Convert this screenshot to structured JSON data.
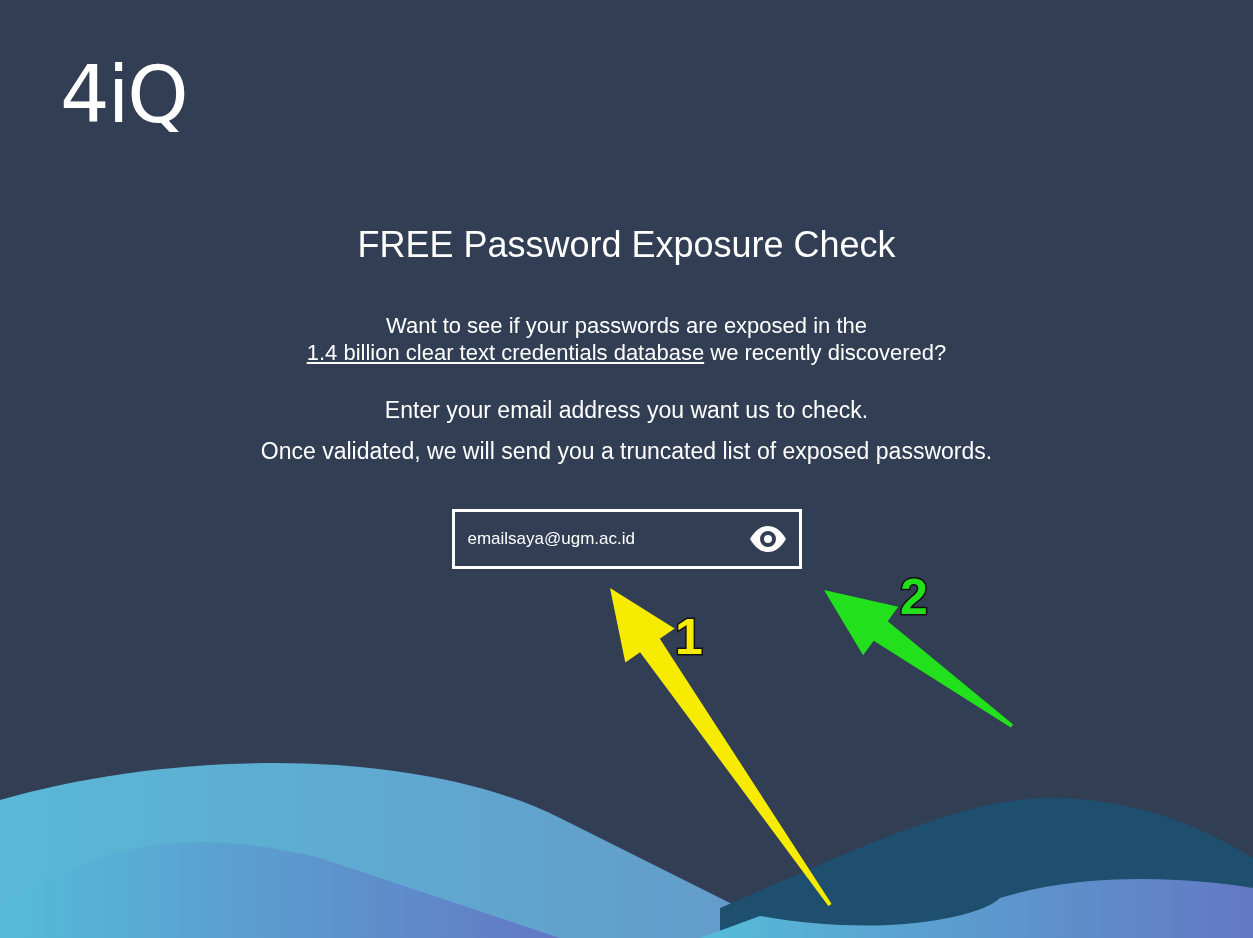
{
  "logo": {
    "text": "4iQ"
  },
  "title": "FREE Password Exposure Check",
  "intro": {
    "before": "Want to see if your passwords are exposed in the",
    "link": "1.4 billion clear text credentials database",
    "after": "we recently discovered?"
  },
  "instructions": [
    "Enter your email address you want us to check.",
    "Once validated, we will send you a truncated list of exposed passwords."
  ],
  "email_field": {
    "value": "emailsaya@ugm.ac.id"
  },
  "annotations": [
    {
      "label": "1",
      "color": "#f7ec00"
    },
    {
      "label": "2",
      "color": "#22e01c"
    }
  ]
}
